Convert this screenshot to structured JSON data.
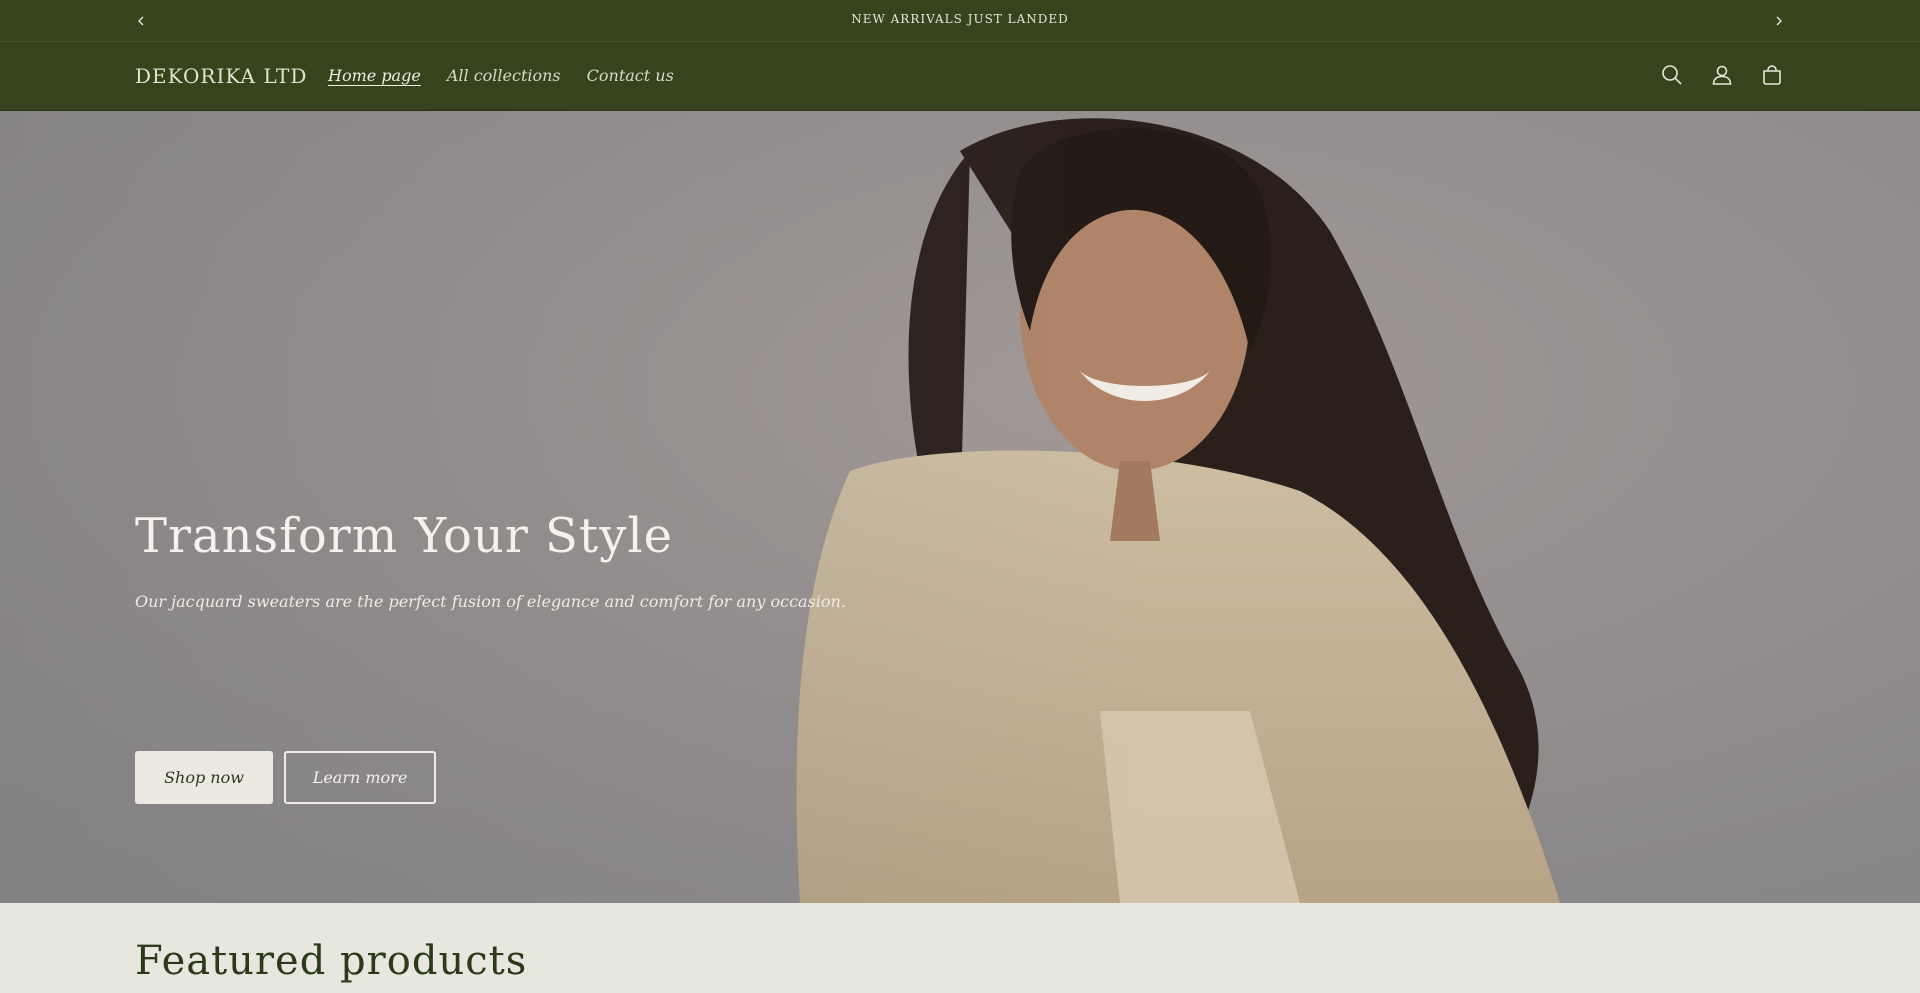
{
  "announcement": {
    "text": "NEW ARRIVALS JUST LANDED"
  },
  "header": {
    "logo": "DEKORIKA LTD",
    "nav": [
      {
        "label": "Home page",
        "active": true
      },
      {
        "label": "All collections",
        "active": false
      },
      {
        "label": "Contact us",
        "active": false
      }
    ],
    "icons": [
      "search-icon",
      "account-icon",
      "cart-icon"
    ]
  },
  "hero": {
    "title": "Transform Your Style",
    "subtitle": "Our jacquard sweaters are the perfect fusion of elegance and comfort for any occasion.",
    "primary_button": "Shop now",
    "secondary_button": "Learn more"
  },
  "featured": {
    "title": "Featured products"
  },
  "colors": {
    "header_bg": "#36441e",
    "page_bg": "#e8e7df",
    "heading_text": "#2d3a1a"
  }
}
